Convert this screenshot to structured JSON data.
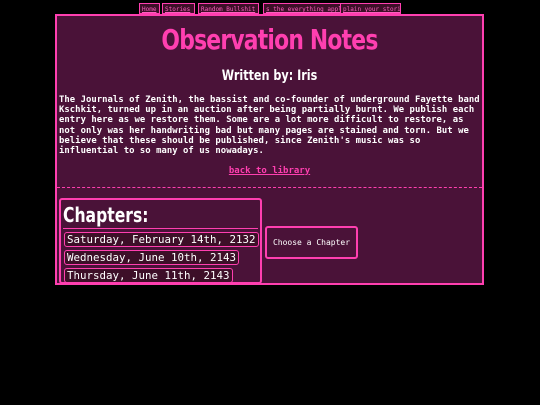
{
  "nav": {
    "items": [
      {
        "label": "Home"
      },
      {
        "label": "Stories"
      },
      {
        "label": "Random Bullshit"
      },
      {
        "label": "s the everything appl"
      },
      {
        "label": "plain your storie"
      }
    ]
  },
  "page": {
    "title": "Observation Notes",
    "author": "Written by: Iris",
    "intro": "The Journals of Zenith, the bassist and co-founder of underground Fayette band Kschkit, turned up in an auction after being partially burnt. We publish each entry here as we restore them. Some are a lot more difficult to restore, as not only was her handwriting bad but many pages are stained and torn. But we believe that these should be published, since Zenith's music was so influential to so many of us nowadays.",
    "back_link": "back to library"
  },
  "chapters": {
    "heading": "Chapters:",
    "items": [
      {
        "label": "Saturday, February 14th, 2132"
      },
      {
        "label": "Wednesday, June 10th, 2143"
      },
      {
        "label": "Thursday, June 11th, 2143"
      }
    ]
  },
  "reader": {
    "placeholder": "Choose a Chapter"
  },
  "colors": {
    "accent": "#ff3fb0",
    "panel_bg": "#4a1238",
    "page_bg": "#000000",
    "text": "#ffffff"
  }
}
